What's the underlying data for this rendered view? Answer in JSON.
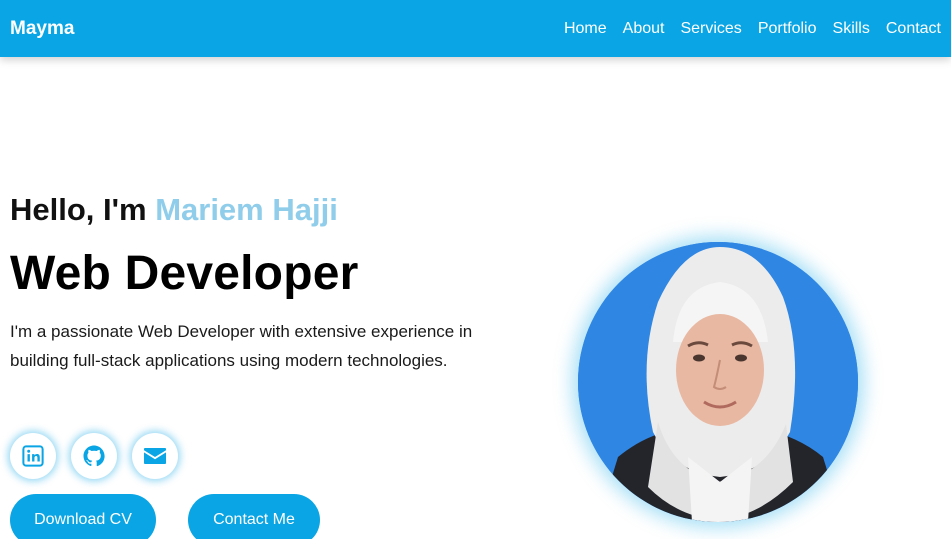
{
  "nav": {
    "brand": "Mayma",
    "links": [
      "Home",
      "About",
      "Services",
      "Portfolio",
      "Skills",
      "Contact"
    ]
  },
  "hero": {
    "greeting": "Hello, I'm ",
    "name": "Mariem Hajji",
    "role": "Web Developer",
    "description": "I'm a passionate Web Developer with extensive experience in building full-stack applications using modern technologies."
  },
  "socials": [
    {
      "icon": "linkedin-icon"
    },
    {
      "icon": "github-icon"
    },
    {
      "icon": "mail-icon"
    }
  ],
  "buttons": {
    "download_cv": "Download CV",
    "contact_me": "Contact Me"
  },
  "colors": {
    "primary": "#0aa5e5",
    "name_accent": "#8fcdea",
    "avatar_bg": "#2f86e3"
  }
}
